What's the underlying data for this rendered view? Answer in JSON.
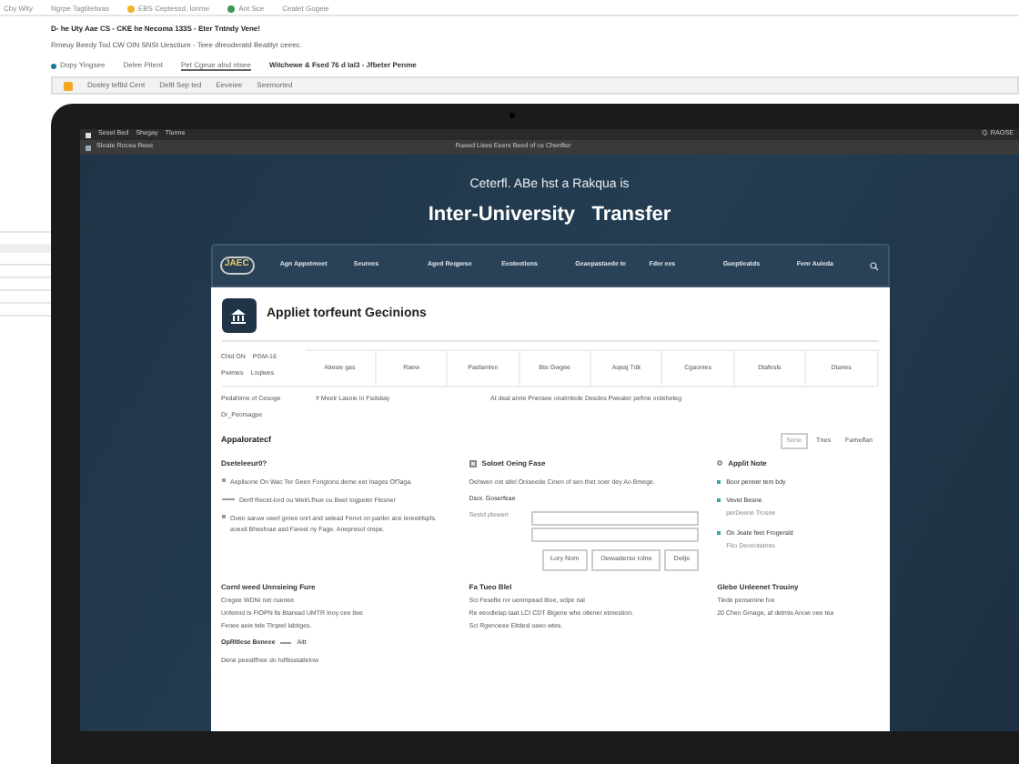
{
  "top_tabs": [
    {
      "label": "Cby Wity"
    },
    {
      "label": "Ngrpe Tagtitetwas"
    },
    {
      "label": "EBS Ceptessd, lonme",
      "color": "#f0b429"
    },
    {
      "label": "Ant Sce",
      "color": "#3a9a5b"
    },
    {
      "label": "Ceatet Gogeie"
    }
  ],
  "page_title": "D- he Uty Aae CS - CKE he Necoma 133S - Eter Tntndy Vene!",
  "page_subtitle": "Rmeuy Beedy Tod CW OIN SNSt Uesctium - Teee dlreoderatd Beatityr ceeec.",
  "link_row": [
    {
      "label": "Dopy Yingsee",
      "kind": "dot"
    },
    {
      "label": "Delee Pitent",
      "kind": "plain"
    },
    {
      "label": "Pet Cgeue alnd ntsee",
      "kind": "link"
    },
    {
      "label": "Witchewe & Fsed 76 d IaI3 - Jfbeter Penme",
      "kind": "bold"
    }
  ],
  "toolbar": [
    "Dosley teftld Cent",
    "Deltt Sep ted",
    "Eeveiee",
    "Seemorted"
  ],
  "screen": {
    "menu_items": [
      "Seset Bed",
      "Shegay",
      "Tlunne"
    ],
    "menu_right": "Q. RAOSE",
    "address": "Sloate Rocea Reee",
    "window_title": "Raeed Lises Eeers Beed of ce Chenfter"
  },
  "hero": {
    "subtitle": "Ceterfl. ABe hst a Rakqua is",
    "title": "Inter-University   Transfer"
  },
  "nav": {
    "logo_text": "JAEC",
    "items": [
      "Agn Appotmeet",
      "Seurees",
      "Aged Reqpese",
      "Eeoteetions",
      "Geaepastaede te",
      "Fder ees",
      "Gueptieatds",
      "Fenr Auieda"
    ]
  },
  "card": {
    "title": "Appliet torfeunt Gecinions",
    "table": {
      "corner": [
        [
          "Chld ON",
          "PGM-16"
        ],
        [
          "Pwimes",
          "Loqlwes"
        ]
      ],
      "columns": [
        "Atiesie gas",
        "Raew",
        "Pasfamlen",
        "Bte Gwgee",
        "Aqeaj Tdit",
        "Cgaonies",
        "Dtafesls",
        "Dtanes"
      ]
    },
    "info_rows": [
      {
        "label": "Pedahime of Cesoge",
        "value": "# Meelr Lasnie lo Fsdstiay",
        "note": "At deal anrie Pneraee onalmlede Desdes Pweater pefme ordeheteg"
      },
      {
        "label": "Dr_Peorsagpe"
      }
    ],
    "section_title": "Appaloratecf",
    "section_buttons": [
      {
        "label": "Sene",
        "selected": true
      },
      {
        "label": "Tnes",
        "selected": false
      },
      {
        "label": "Famelfan",
        "selected": false
      }
    ],
    "left": {
      "title": "Dseteleeur0?",
      "items": [
        {
          "kind": "bullet",
          "text": "Aeplisone On Wac Ter Geen Fongtons deme eet Inages OfTaga."
        },
        {
          "kind": "dash",
          "text": "Dertf Recet-lord ou WelrLfhue ou Beet Iogpeter Flesner"
        },
        {
          "kind": "bullet",
          "text": "Oven saruw oeerl gmee onrt and selead Fenot on panler ace Iereekfspfs. aoexit Bheshrae asd Fareet ny Fage. Anepresol crepe."
        }
      ]
    },
    "middle": {
      "title": "Soloet Oeing Fase",
      "checked": false,
      "desc": "Oehwen ont stlel Oniseede Cinen of sen thet ooer dey Ao Bmege.",
      "field_label": "Dsor. Goserfeae",
      "field_hint": "Sestd plewerr",
      "buttons": [
        "Lory Nom",
        "Oewasterso rolne",
        "Dwlje"
      ]
    },
    "right": {
      "title": "Applit Note",
      "items": [
        {
          "text": "Boor penner tem bdy"
        },
        {
          "text": "Vevet Besne",
          "sub": "perDeene Trosne"
        },
        {
          "text": "On Jeate feet Frogersld",
          "sub": "Fbo Deoeotatnes"
        }
      ]
    },
    "footer": [
      {
        "title": "Cornl weed Unnsieing Fure",
        "lines": [
          "Cregee WDNI net cuenee",
          "Unfemid Is FIOPN lls Btaread UMTR Inoy cee Itee",
          "Fenee aeie tele Tlrqeel labtiges."
        ]
      },
      {
        "title": "Fa Tueo Blel",
        "lines": [
          "Sci Fesefte ror uenmpead Itloe, sclpe rial",
          "Re eeodlelap taat LCI CDT BIgene whe oltener etmestion.",
          "Sci Rgenoeee Eltdesl oaeo wtes."
        ]
      },
      {
        "title": "Glebe Unleenet Trouiny",
        "lines": [
          "Tlede pensenine foe",
          "20 Chen Gmage, af detmis Anow oee tea"
        ]
      }
    ],
    "option_row": {
      "label": "OpRltlese Beneee",
      "value": "Aitt"
    },
    "cut_line": "Dene peestlfhee do hdfbsstatlelow"
  }
}
